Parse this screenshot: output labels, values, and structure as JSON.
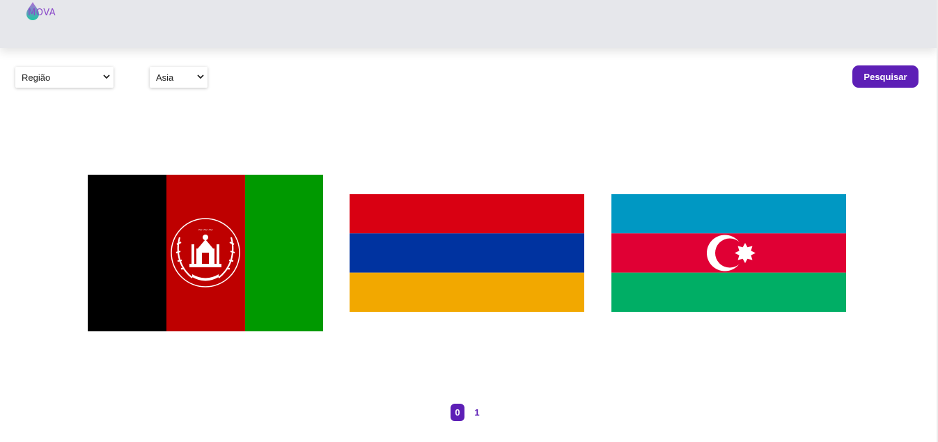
{
  "header": {
    "logo_text": "MOVA"
  },
  "filters": {
    "region_select": "Região",
    "continent_select": "Asia",
    "search_label": "Pesquisar"
  },
  "flags": [
    {
      "icon": "afghanistan-flag"
    },
    {
      "icon": "armenia-flag"
    },
    {
      "icon": "azerbaijan-flag"
    }
  ],
  "pagination": {
    "current": "0",
    "next": "1"
  },
  "colors": {
    "accent": "#5d1fb6",
    "header_bg": "#e6e7eb",
    "logo_teal": "#1fc7a3",
    "logo_purple": "#8a49c9"
  }
}
